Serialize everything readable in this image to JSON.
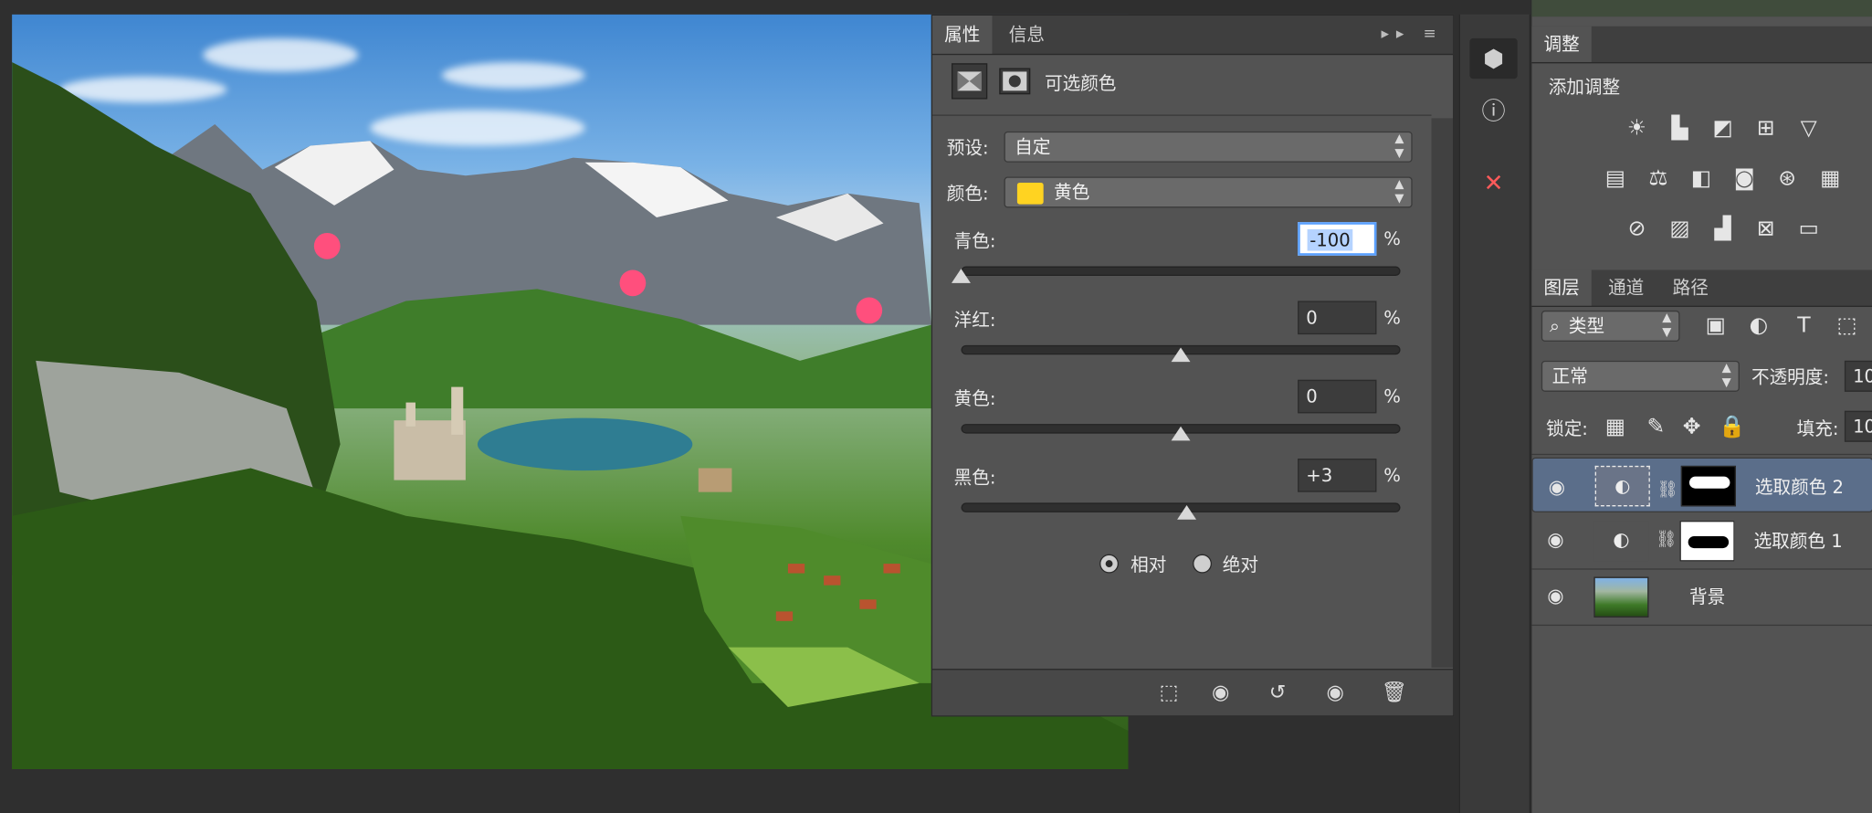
{
  "properties_panel": {
    "tabs": [
      "属性",
      "信息"
    ],
    "title": "可选颜色",
    "preset_label": "预设:",
    "preset_value": "自定",
    "color_label": "颜色:",
    "color_value": "黄色",
    "color_swatch": "#ffd321",
    "sliders": [
      {
        "label": "青色:",
        "value": "-100",
        "percent": 0.0
      },
      {
        "label": "洋红:",
        "value": "0",
        "percent": 0.5
      },
      {
        "label": "黄色:",
        "value": "0",
        "percent": 0.5
      },
      {
        "label": "黑色:",
        "value": "+3",
        "percent": 0.515
      }
    ],
    "percent_sign": "%",
    "method_relative": "相对",
    "method_absolute": "绝对",
    "method_selected": "relative"
  },
  "adjustments_panel": {
    "tab": "调整",
    "add_label": "添加调整",
    "icons": [
      "brightness-icon",
      "levels-icon",
      "curves-icon",
      "exposure-icon",
      "vibrance-icon",
      "hue-saturation-icon",
      "color-balance-icon",
      "black-white-icon",
      "photo-filter-icon",
      "channel-mixer-icon",
      "color-lookup-icon",
      "invert-icon",
      "posterize-icon",
      "threshold-icon",
      "selective-color-icon",
      "gradient-map-icon"
    ]
  },
  "layers_panel": {
    "tabs": [
      "图层",
      "通道",
      "路径"
    ],
    "filter_label": "类型",
    "blend_mode": "正常",
    "opacity_label": "不透明度:",
    "opacity_value": "10",
    "lock_label": "锁定:",
    "fill_label": "填充:",
    "fill_value": "10",
    "layers": [
      {
        "name": "选取颜色 2",
        "selected": true
      },
      {
        "name": "选取颜色 1",
        "selected": false
      },
      {
        "name": "背景",
        "selected": false
      }
    ]
  },
  "colors": {
    "accent": "#5aa0ff",
    "selected_layer": "#5b6e8a",
    "panel": "#535353"
  }
}
